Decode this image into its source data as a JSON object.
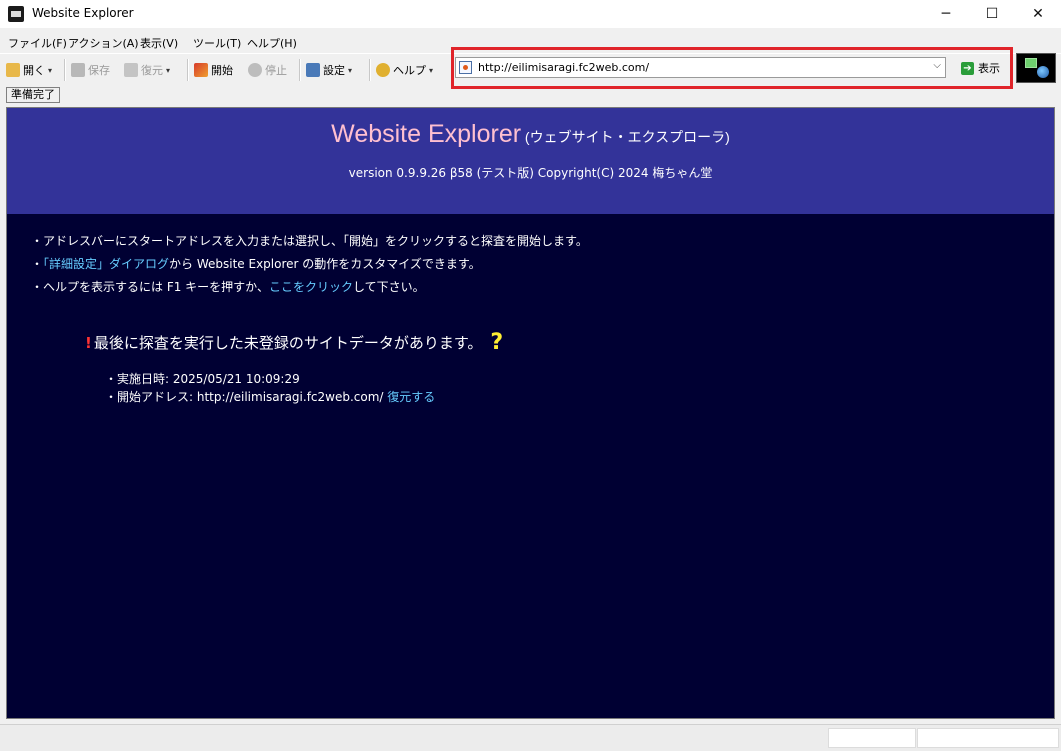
{
  "window": {
    "title": "Website Explorer",
    "controls": {
      "minimize": "─",
      "maximize": "☐",
      "close": "✕"
    }
  },
  "menubar": {
    "items": [
      {
        "label": "ファイル(F)"
      },
      {
        "label": "アクション(A)"
      },
      {
        "label": "表示(V)"
      },
      {
        "label": "ツール(T)"
      },
      {
        "label": "ヘルプ(H)"
      }
    ]
  },
  "toolbar": {
    "open_label": "開く",
    "save_label": "保存",
    "restore_label": "復元",
    "start_label": "開始",
    "stop_label": "停止",
    "settings_label": "設定",
    "help_label": "ヘルプ",
    "dropdown_glyph": "▾"
  },
  "address": {
    "url": "http://eilimisaragi.fc2web.com/",
    "dropdown_glyph": "⌵",
    "go_label": "表示",
    "go_glyph": "➔",
    "highlight_color": "#e0242a"
  },
  "status": {
    "text": "準備完了"
  },
  "content": {
    "brand_name": "Website Explorer",
    "brand_sub": "(ウェブサイト・エクスプローラ)",
    "version": "version 0.9.9.26 β58 (テスト版) Copyright(C) 2024 梅ちゃん堂",
    "bullet_prefix": "・",
    "bullet1": "アドレスバーにスタートアドレスを入力または選択し、「開始」をクリックすると探査を開始します。",
    "bullet2_link": "「詳細設定」ダイアログ",
    "bullet2_rest": "から Website Explorer の動作をカスタマイズできます。",
    "bullet3_pre": "ヘルプを表示するには F1 キーを押すか、",
    "bullet3_link": "ここをクリック",
    "bullet3_post": "して下さい。",
    "notice_mark": "!",
    "notice_text": "最後に探査を実行した未登録のサイトデータがあります。",
    "notice_q": "?",
    "detail_prefix": "・",
    "detail1": "実施日時: 2025/05/21 10:09:29",
    "detail2_pre": "開始アドレス: http://eilimisaragi.fc2web.com/",
    "detail2_link": "復元する"
  },
  "colors": {
    "banner": "#333399",
    "content_bg": "#000033",
    "brand": "#ffc0d0",
    "link": "#66ccff"
  }
}
